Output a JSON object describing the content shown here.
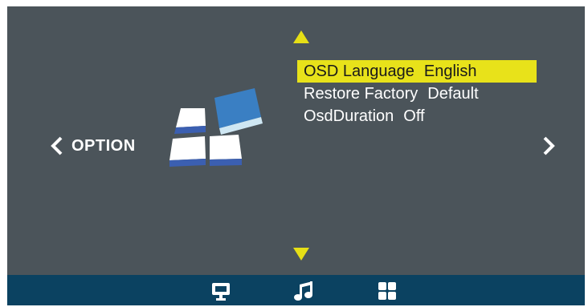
{
  "osd": {
    "side_title": "OPTION",
    "icons": {
      "up": "triangle-up-icon",
      "down": "triangle-down-icon",
      "left": "chevron-left-icon",
      "right": "chevron-right-icon",
      "graphic": "option-grid-icon"
    },
    "menu_items": [
      {
        "label": "OSD Language",
        "value": "English",
        "selected": true
      },
      {
        "label": "Restore Factory",
        "value": "Default",
        "selected": false
      },
      {
        "label": "OsdDuration",
        "value": "Off",
        "selected": false
      }
    ],
    "footer_icons": [
      {
        "name": "monitor-icon"
      },
      {
        "name": "music-note-icon"
      },
      {
        "name": "grid-apps-icon"
      }
    ]
  },
  "colors": {
    "background": "#4b545a",
    "highlight": "#e8e21a",
    "arrow": "#e6df16",
    "footer": "#0b4261",
    "text": "#ffffff"
  }
}
